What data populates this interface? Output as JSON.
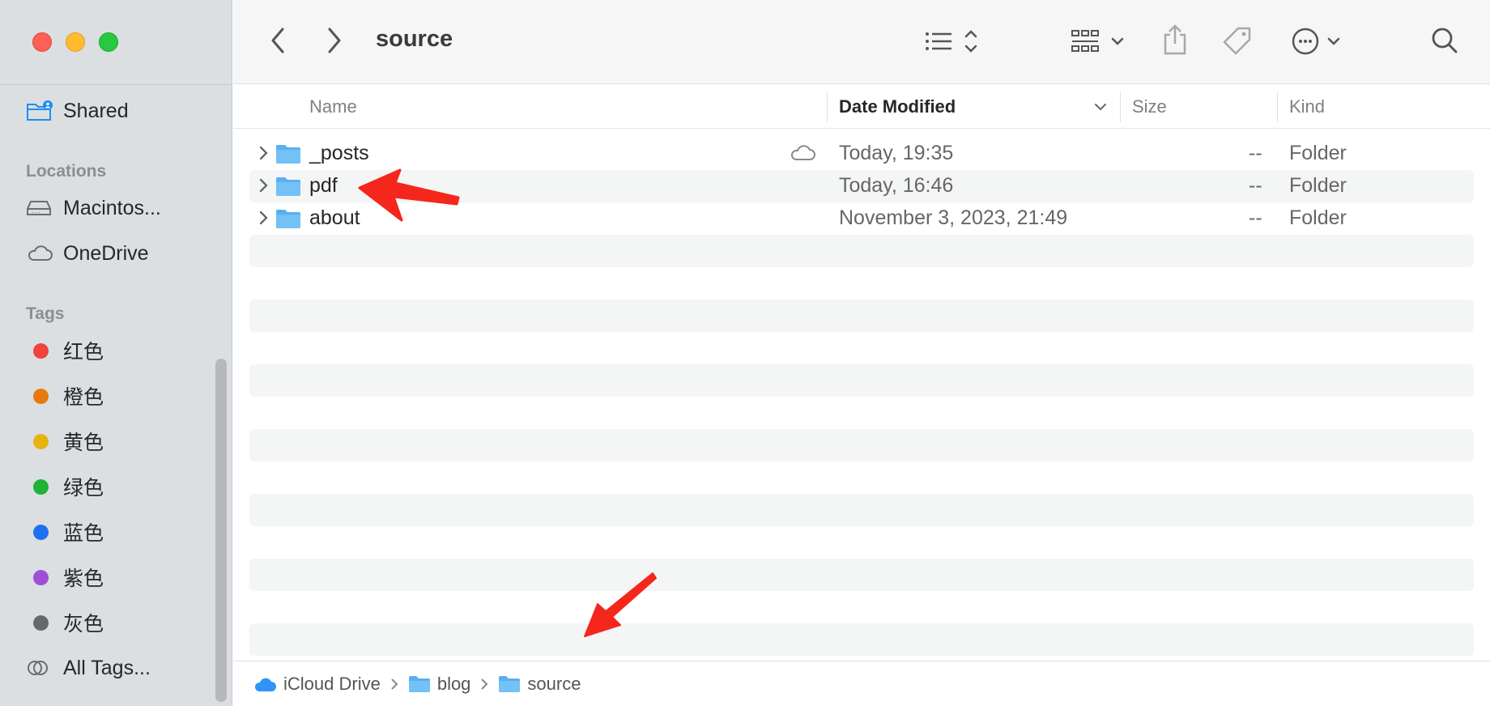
{
  "window": {
    "title": "source"
  },
  "toolbar": {
    "back_icon": "chevron-left-icon",
    "forward_icon": "chevron-right-icon",
    "view_icon": "list-view-icon",
    "group_icon": "grid-group-icon",
    "share_icon": "share-icon",
    "tag_icon": "tag-icon",
    "more_icon": "ellipsis-circle-icon",
    "search_icon": "search-icon"
  },
  "sidebar": {
    "shared_label": "Shared",
    "locations_header": "Locations",
    "locations": [
      {
        "label": "Macintos...",
        "icon": "harddrive-icon"
      },
      {
        "label": "OneDrive",
        "icon": "cloud-icon"
      }
    ],
    "tags_header": "Tags",
    "tags": [
      {
        "label": "红色",
        "color": "#f0443a"
      },
      {
        "label": "橙色",
        "color": "#e8790c"
      },
      {
        "label": "黄色",
        "color": "#e5b40f"
      },
      {
        "label": "绿色",
        "color": "#20b233"
      },
      {
        "label": "蓝色",
        "color": "#1f6ff0"
      },
      {
        "label": "紫色",
        "color": "#9e4fd6"
      },
      {
        "label": "灰色",
        "color": "#68686b"
      }
    ],
    "all_tags_label": "All Tags..."
  },
  "columns": {
    "name": "Name",
    "date_modified": "Date Modified",
    "size": "Size",
    "kind": "Kind"
  },
  "files": [
    {
      "name": "_posts",
      "date": "Today, 19:35",
      "size": "--",
      "kind": "Folder",
      "icloud": true
    },
    {
      "name": "pdf",
      "date": "Today, 16:46",
      "size": "--",
      "kind": "Folder",
      "icloud": false
    },
    {
      "name": "about",
      "date": "November 3, 2023, 21:49",
      "size": "--",
      "kind": "Folder",
      "icloud": false
    }
  ],
  "pathbar": {
    "crumbs": [
      "iCloud Drive",
      "blog",
      "source"
    ]
  },
  "colors": {
    "accent": "#1f8ef1",
    "folder": "#5ab0ef",
    "annotation_arrow": "#f5261b"
  }
}
